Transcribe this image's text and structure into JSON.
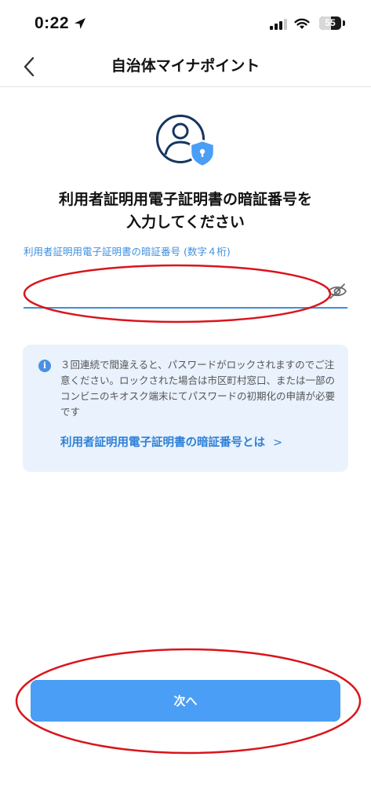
{
  "status_bar": {
    "time": "0:22",
    "battery_level": "55",
    "battery_fraction": 0.55
  },
  "nav": {
    "title": "自治体マイナポイント",
    "back_icon": "chevron-left-icon"
  },
  "hero": {
    "icon": "user-shield-icon"
  },
  "heading": {
    "line1": "利用者証明用電子証明書の暗証番号を",
    "line2": "入力してください"
  },
  "pin_field": {
    "label": "利用者証明用電子証明書の暗証番号 (数字４桁)",
    "value": "",
    "placeholder": ""
  },
  "info": {
    "text": "３回連続で間違えると、パスワードがロックされますのでご注意ください。ロックされた場合は市区町村窓口、または一部のコンビニのキオスク端末にてパスワードの初期化の申請が必要です",
    "link_label": "利用者証明用電子証明書の暗証番号とは",
    "link_chevron": ">"
  },
  "footer": {
    "next_label": "次へ"
  },
  "colors": {
    "accent": "#4a9ef5",
    "link": "#2f80d6",
    "info_bg": "#e9f2fd",
    "annotation": "#d9151b"
  }
}
